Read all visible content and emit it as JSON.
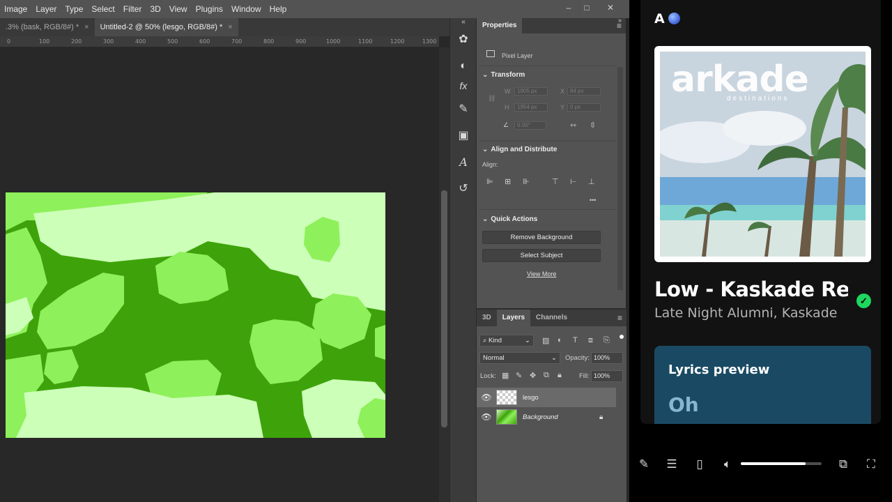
{
  "menubar": {
    "items": [
      "Image",
      "Layer",
      "Type",
      "Select",
      "Filter",
      "3D",
      "View",
      "Plugins",
      "Window",
      "Help"
    ],
    "controls": {
      "minimize": "–",
      "maximize": "□",
      "close": "✕"
    }
  },
  "doc_tabs": [
    {
      "label": ".3% (bask, RGB/8#) *",
      "close": "×"
    },
    {
      "label": "Untitled-2 @ 50% (lesgo, RGB/8#) *",
      "close": "×"
    }
  ],
  "ruler": {
    "labels": [
      "0",
      "100",
      "200",
      "300",
      "400",
      "500",
      "600",
      "700",
      "800",
      "900",
      "1000",
      "1100",
      "1200",
      "1300"
    ]
  },
  "properties": {
    "tab": "Properties",
    "layer_type": "Pixel Layer",
    "transform": {
      "title": "Transform",
      "w_label": "W",
      "w_value": "1905 px",
      "x_label": "X",
      "x_value": "84 px",
      "h_label": "H",
      "h_value": "1954 px",
      "y_label": "Y",
      "y_value": "0 px",
      "angle_value": "0.00°"
    },
    "align": {
      "title": "Align and Distribute",
      "label": "Align:",
      "more": "•••"
    },
    "quick_actions": {
      "title": "Quick Actions",
      "remove_bg": "Remove Background",
      "select_subject": "Select Subject",
      "view_more": "View More"
    }
  },
  "layers_panel": {
    "tabs": [
      "3D",
      "Layers",
      "Channels"
    ],
    "filter_kind": "Kind",
    "blend_mode": "Normal",
    "opacity_label": "Opacity:",
    "opacity_value": "100%",
    "lock_label": "Lock:",
    "fill_label": "Fill:",
    "fill_value": "100%",
    "layers": [
      {
        "name": "lesgo",
        "italic": false
      },
      {
        "name": "Background",
        "italic": true
      }
    ]
  },
  "spotify": {
    "header_letter": "A",
    "album_text": "arkade",
    "album_subtext": "destinations",
    "track_title": "Low - Kaskade Remi",
    "artists": "Late Night Alumni, Kaskade",
    "check_icon": "✓",
    "lyrics_title": "Lyrics preview",
    "lyrics_line": "Oh",
    "volume": 0.8
  },
  "colors": {
    "green_dark": "#3ea30a",
    "green_mid": "#8ef05a",
    "green_light": "#ccffb8",
    "spotify_green": "#1ed760",
    "lyrics_bg": "#1a4a63"
  }
}
